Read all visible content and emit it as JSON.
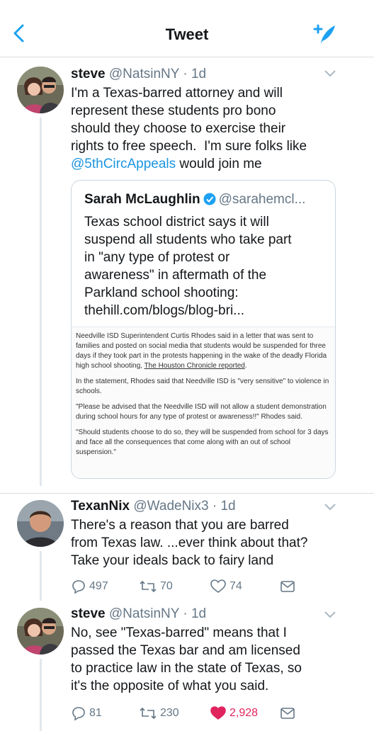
{
  "header": {
    "title": "Tweet"
  },
  "tweet1": {
    "name": "steve",
    "handle": "@NatsinNY",
    "dot": "·",
    "time": "1d",
    "lines": [
      "I'm a Texas-barred attorney and will",
      "represent these students pro bono",
      "should they choose to exercise their",
      "rights to free speech.  I'm sure folks like"
    ],
    "mention": "@5thCircAppeals",
    "tail": " would join me",
    "quote": {
      "name": "Sarah McLaughlin",
      "handle": "@sarahemcl...",
      "lines": [
        "Texas school district says it will",
        "suspend all students who take part",
        "in \"any type of protest or",
        "awareness\" in aftermath of the",
        "Parkland school shooting:",
        "thehill.com/blogs/blog-bri..."
      ],
      "article": {
        "p1": "Needville ISD Superintendent Curtis Rhodes said in a letter that was sent to families and posted on social media that students would be suspended for three days if they took part in the protests happening in the wake of the deadly Florida high school shooting, ",
        "p1_link": "The Houston Chronicle reported",
        "p1_end": ".",
        "p2": "In the statement, Rhodes said that Needville ISD is \"very sensitive\" to violence in schools.",
        "p3": "\"Please be advised that the Needville ISD will not allow a student demonstration during school hours for any type of protest or awareness!!\" Rhodes said.",
        "p4": "\"Should students choose to do so, they will be suspended from school for 3 days and face all the consequences that come along with an out of school suspension.\""
      }
    }
  },
  "tweet2": {
    "name": "TexanNix",
    "handle": "@WadeNix3",
    "dot": "·",
    "time": "1d",
    "lines": [
      "There's a reason that you are barred",
      "from Texas law. ...ever think about that?",
      "Take your ideals back to fairy land"
    ],
    "replies": "497",
    "retweets": "70",
    "likes": "74"
  },
  "tweet3": {
    "name": "steve",
    "handle": "@NatsinNY",
    "dot": "·",
    "time": "1d",
    "lines": [
      "No, see \"Texas-barred\" means that I",
      "passed the Texas bar and am licensed",
      "to practice law in the state of Texas, so",
      "it's the opposite of what you said."
    ],
    "replies": "81",
    "retweets": "230",
    "likes": "2,928"
  },
  "colors": {
    "link": "#1b95e0",
    "like": "#e0245e",
    "muted": "#657786",
    "border": "#d9dee2"
  },
  "icons": [
    "back-chevron-icon",
    "compose-tweet-icon",
    "chevron-down-icon",
    "verified-badge-icon",
    "reply-icon",
    "retweet-icon",
    "like-icon",
    "message-icon"
  ]
}
